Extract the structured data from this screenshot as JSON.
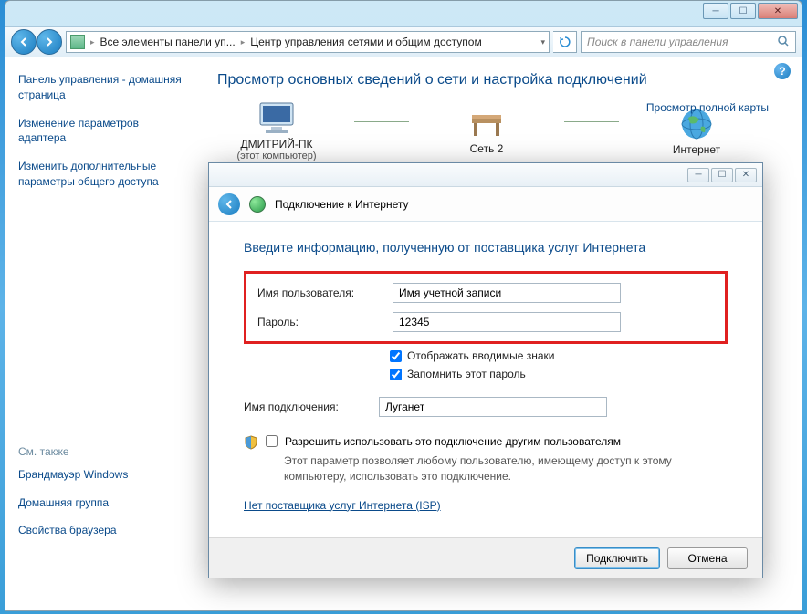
{
  "window": {
    "breadcrumb1": "Все элементы панели уп...",
    "breadcrumb2": "Центр управления сетями и общим доступом",
    "search_placeholder": "Поиск в панели управления"
  },
  "sidebar": {
    "link1": "Панель управления - домашняя страница",
    "link2": "Изменение параметров адаптера",
    "link3": "Изменить дополнительные параметры общего доступа",
    "see_also": "См. также",
    "sa1": "Брандмауэр Windows",
    "sa2": "Домашняя группа",
    "sa3": "Свойства браузера"
  },
  "main": {
    "heading": "Просмотр основных сведений о сети и настройка подключений",
    "map_link": "Просмотр полной карты",
    "node1": "ДМИТРИЙ-ПК",
    "node1_sub": "(этот компьютер)",
    "node2": "Сеть 2",
    "node3": "Интернет"
  },
  "dialog": {
    "title": "Подключение к Интернету",
    "heading": "Введите информацию, полученную от поставщика услуг Интернета",
    "lbl_user": "Имя пользователя:",
    "val_user": "Имя учетной записи",
    "lbl_pass": "Пароль:",
    "val_pass": "12345",
    "chk_show": "Отображать вводимые знаки",
    "chk_remember": "Запомнить этот пароль",
    "lbl_conn": "Имя подключения:",
    "val_conn": "Луганет",
    "chk_permit": "Разрешить использовать это подключение другим пользователям",
    "permit_desc": "Этот параметр позволяет любому пользователю, имеющему доступ к этому компьютеру, использовать это подключение.",
    "isp_link": "Нет поставщика услуг Интернета (ISP)",
    "btn_connect": "Подключить",
    "btn_cancel": "Отмена"
  }
}
